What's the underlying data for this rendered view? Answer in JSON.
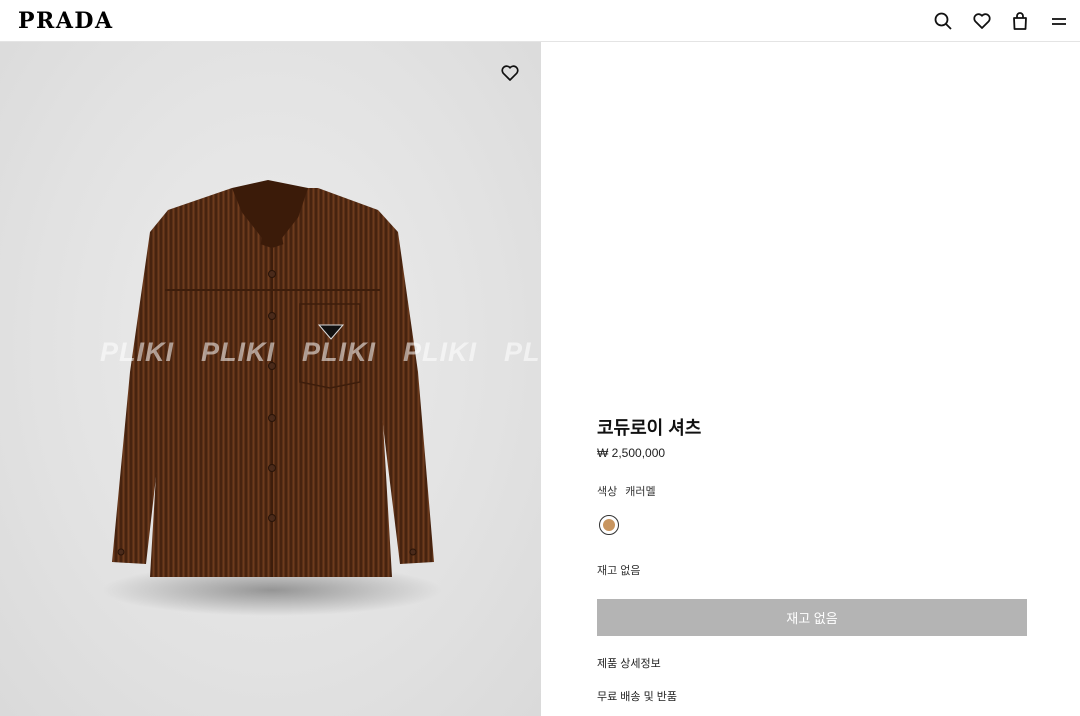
{
  "header": {
    "logo": "PRADA",
    "icons": [
      "search-icon",
      "heart-icon",
      "bag-icon",
      "menu-icon"
    ]
  },
  "media": {
    "watermark": [
      "PLIKI",
      "PLIKI",
      "PLIKI",
      "PLIKI",
      "PLIKI"
    ],
    "wishlist_icon": "heart-icon"
  },
  "product": {
    "title": "코듀로이 셔츠",
    "price": "₩ 2,500,000",
    "color_label": "색상",
    "color_value": "캐러멜",
    "swatch_color": "#c8955f",
    "stock_status": "재고 없음",
    "button_label": "재고 없음",
    "links": [
      "제품 상세정보",
      "무료 배송 및 반품"
    ]
  },
  "colors": {
    "shirt": "#5a3017",
    "button_disabled": "#b4b4b4"
  }
}
